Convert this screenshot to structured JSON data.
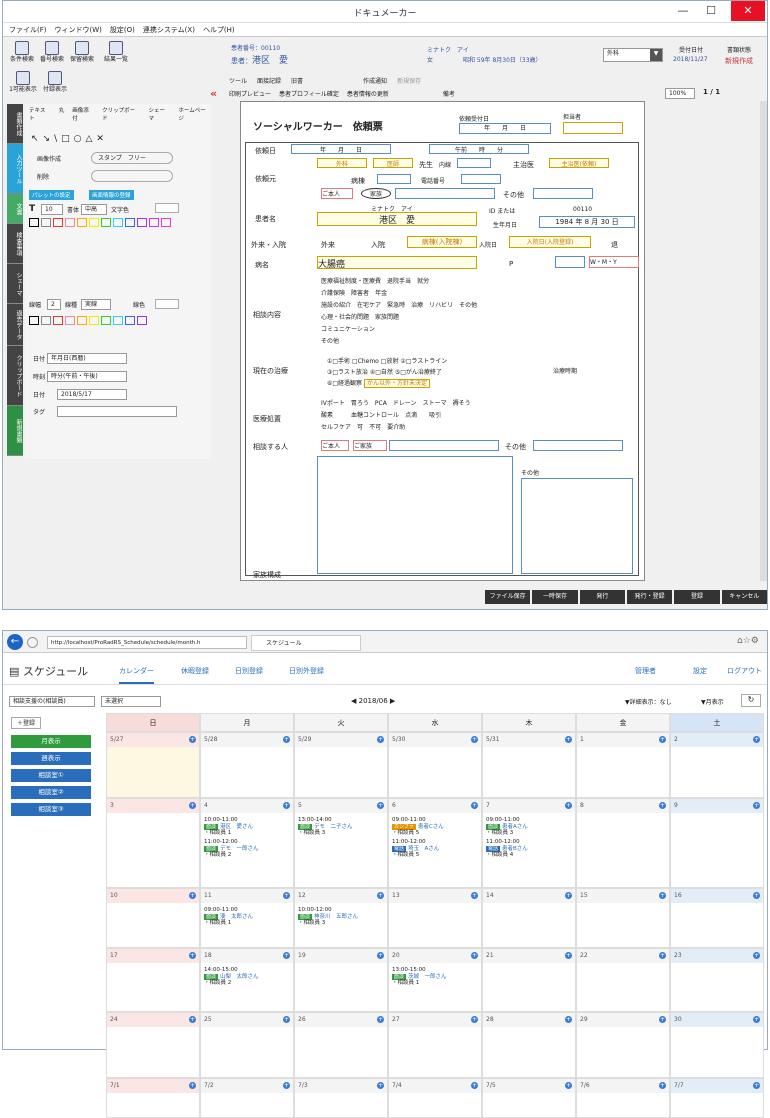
{
  "app1": {
    "title": "ドキュメーカー",
    "menus": [
      "ファイル(F)",
      "ウィンドウ(W)",
      "設定(O)",
      "連携システム(X)",
      "ヘルプ(H)"
    ],
    "toolbar": [
      "条件検索",
      "番号検索",
      "保留検索",
      "結果一覧"
    ],
    "toolbar2": [
      "1可能表示",
      "付録表示"
    ],
    "patient": {
      "no_label": "患者番号：",
      "no": "00110",
      "name_label": "患者：",
      "name": "港区　愛",
      "kana": "ミナトク　アイ",
      "sex": "女",
      "birth": "昭和 59年 8月30日（33歳）"
    },
    "status_select": "外科",
    "date_label": "受付日付",
    "date": "2018/11/27",
    "doc_label": "書類状態",
    "doc_status": "新規作成",
    "row_tools": [
      "ツール",
      "面接記録",
      "旧書",
      "作成通知",
      "新規保存"
    ],
    "row_tools2": [
      "印刷プレビュー",
      "患者プロフィール確定",
      "患者情報の更新",
      "備考"
    ],
    "page_select": "100%",
    "page": "1 / 1",
    "side_tabs": [
      "書類作成",
      "入力ツール",
      "文書",
      "検査事項",
      "シェーマ",
      "過去データ",
      "クリップボード",
      "新規書類"
    ],
    "palette": {
      "tools": [
        "テキスト",
        "丸",
        "画像添付",
        "クリップボード",
        "シェーマ",
        "ホームページ"
      ],
      "stamp_label": "画像作成",
      "stamp": "スタンプ",
      "free": "フリー",
      "delete": "削除",
      "pallet_btn": "パレットの設定",
      "pallet_btn2": "画面情報の登録",
      "font_size": "10",
      "font_label": "書体",
      "font_value": "中高",
      "char_label": "文字色",
      "line_label": "線幅",
      "line_value": "2",
      "kind_label": "線種",
      "kind_value": "実線",
      "linecolor_label": "線色",
      "date_label": "日付",
      "date_value": "年月日(西暦)",
      "time_label": "時刻",
      "time_value": "時分(午前・午後)",
      "stamp_date_label": "日付",
      "stamp_date": "2018/5/17",
      "tag_label": "タグ"
    },
    "form": {
      "title": "ソーシャルワーカー　依頼票",
      "reception_label": "依頼受付日",
      "year_month_day": "年　　月　　日",
      "staff_label": "担当者",
      "request_date": "依頼日",
      "ymd": "年　　月　　日",
      "time_label": "午前　　時　　分",
      "requester": "依頼元",
      "dept": "外科",
      "doctor_label": "医",
      "doctor": "医師",
      "teacher": "先生",
      "ext": "内線",
      "chief_label": "主治医",
      "chief_value": "主治医(依頼)",
      "ward": "病棟",
      "phone": "電話番号",
      "self": "ご本人",
      "family": "家族",
      "other": "その他",
      "patient_label": "患者名",
      "patient_kana": "ミナトク　アイ",
      "patient_name": "港区　愛",
      "id_label": "ID または",
      "id_value": "00110",
      "birth_label": "生年月日",
      "birth_value": "1984 年 8 月 30 日",
      "visit_label": "外来・入院",
      "visit_out": "外来",
      "visit_in": "入院",
      "stay": "病棟(入院棟)",
      "stay_date": "入院日",
      "stay_value": "入院日(入院登録)",
      "leave": "退",
      "disease_label": "病名",
      "disease": "大腸癌",
      "p": "P",
      "wmy": "W・M・Y",
      "content_label": "相談内容",
      "contents": [
        "医療福祉制度・医療費",
        "退院手当",
        "就労",
        "介護保険",
        "障害者",
        "年金",
        "施設の紹介",
        "在宅ケア",
        "緊急時",
        "治療",
        "リハビリ",
        "その他",
        "心理・社会的問題",
        "家族問題",
        "コミュニケーション",
        "その他"
      ],
      "cur_label": "現在の治療",
      "cur": [
        "①□手術",
        "□Chemo",
        "□放射",
        "②□ラストライン",
        "③□ラスト放治",
        "④□自然",
        "⑤□がん治療終了",
        "⑥□経過観察"
      ],
      "cur_note": "がん以外・方針未決定",
      "period_label": "治療時期",
      "med_label": "医療処置",
      "meds": [
        "IVポート",
        "胃ろう",
        "PCA",
        "ドレーン",
        "ストーマ",
        "褥そう",
        "酸素",
        "血糖コントロール",
        "点滴",
        "吸引"
      ],
      "self_care": "セルフケア",
      "selfcare_opts": [
        "可",
        "不可",
        "要介助"
      ],
      "consult_label": "相談する人",
      "consult_self": "ご本人",
      "consult_family": "ご家族",
      "consult_other": "その他",
      "family_label": "家族構成",
      "others": "その他"
    },
    "buttons": [
      "ファイル保存",
      "一時保存",
      "発行",
      "発行・登録",
      "登録",
      "キャンセル"
    ]
  },
  "app2": {
    "url": "http://localhost/ProRadRS_Schedule/schedule/month.h",
    "tab": "スケジュール",
    "title": "スケジュール",
    "nav": [
      "カレンダー",
      "休暇登録",
      "日別登録",
      "日別外登録"
    ],
    "manager": "管理者",
    "settings": "設定",
    "logout": "ログアウト",
    "filter1": "相談支援の(相談員)",
    "filter2": "未選択",
    "month": "2018/06",
    "detail": "▼詳細表示：なし",
    "month_display": "▼月表示",
    "left_buttons": [
      "月表示",
      "週表示",
      "相談室①",
      "相談室②",
      "相談室③"
    ],
    "add": "＋登録",
    "weekdays": [
      "日",
      "月",
      "火",
      "水",
      "木",
      "金",
      "土"
    ],
    "weeks": [
      [
        "5/27",
        "5/28",
        "5/29",
        "5/30",
        "5/31",
        "1",
        "2"
      ],
      [
        "3",
        "4",
        "5",
        "6",
        "7",
        "8",
        "9"
      ],
      [
        "10",
        "11",
        "12",
        "13",
        "14",
        "15",
        "16"
      ],
      [
        "17",
        "18",
        "19",
        "20",
        "21",
        "22",
        "23"
      ],
      [
        "24",
        "25",
        "26",
        "27",
        "28",
        "29",
        "30"
      ],
      [
        "7/1",
        "7/2",
        "7/3",
        "7/4",
        "7/5",
        "7/6",
        "7/7"
      ]
    ],
    "events": [
      {
        "w": 1,
        "d": 1,
        "i": 0,
        "time": "10:00-11:00",
        "tag": "面談",
        "tc": "g",
        "who": "港区　愛さん",
        "staff": "・相談員 1"
      },
      {
        "w": 1,
        "d": 1,
        "i": 1,
        "time": "11:00-12:00",
        "tag": "面談",
        "tc": "g",
        "who": "デモ　一郎さん",
        "staff": "・相談員 2"
      },
      {
        "w": 1,
        "d": 2,
        "i": 0,
        "time": "13:00-14:00",
        "tag": "面談",
        "tc": "g",
        "who": "デモ　二子さん",
        "staff": "・相談員 3"
      },
      {
        "w": 1,
        "d": 3,
        "i": 0,
        "time": "09:00-11:00",
        "tag": "カンファ",
        "tc": "o",
        "who": "患者Cさん",
        "staff": "・相談員 5"
      },
      {
        "w": 1,
        "d": 3,
        "i": 1,
        "time": "11:00-12:00",
        "tag": "電話",
        "tc": "b",
        "who": "埼玉　Aさん",
        "staff": "・相談員 5"
      },
      {
        "w": 1,
        "d": 4,
        "i": 0,
        "time": "09:00-11:00",
        "tag": "面談",
        "tc": "g",
        "who": "患者Aさん",
        "staff": "・相談員 3"
      },
      {
        "w": 1,
        "d": 4,
        "i": 1,
        "time": "11:00-12:00",
        "tag": "電話",
        "tc": "b",
        "who": "患者Bさん",
        "staff": "・相談員 4"
      },
      {
        "w": 2,
        "d": 1,
        "i": 0,
        "time": "09:00-11:00",
        "tag": "面談",
        "tc": "g",
        "who": "湊　太郎さん",
        "staff": "・相談員 1"
      },
      {
        "w": 2,
        "d": 2,
        "i": 0,
        "time": "10:00-12:00",
        "tag": "面談",
        "tc": "g",
        "who": "神奈川　五郎さん",
        "staff": "・相談員 3"
      },
      {
        "w": 3,
        "d": 1,
        "i": 0,
        "time": "14:00-15:00",
        "tag": "面談",
        "tc": "g",
        "who": "山梨　太郎さん",
        "staff": "・相談員 2"
      },
      {
        "w": 3,
        "d": 3,
        "i": 0,
        "time": "13:00-15:00",
        "tag": "面談",
        "tc": "g",
        "who": "茨城　一郎さん",
        "staff": "・相談員 1"
      }
    ]
  }
}
